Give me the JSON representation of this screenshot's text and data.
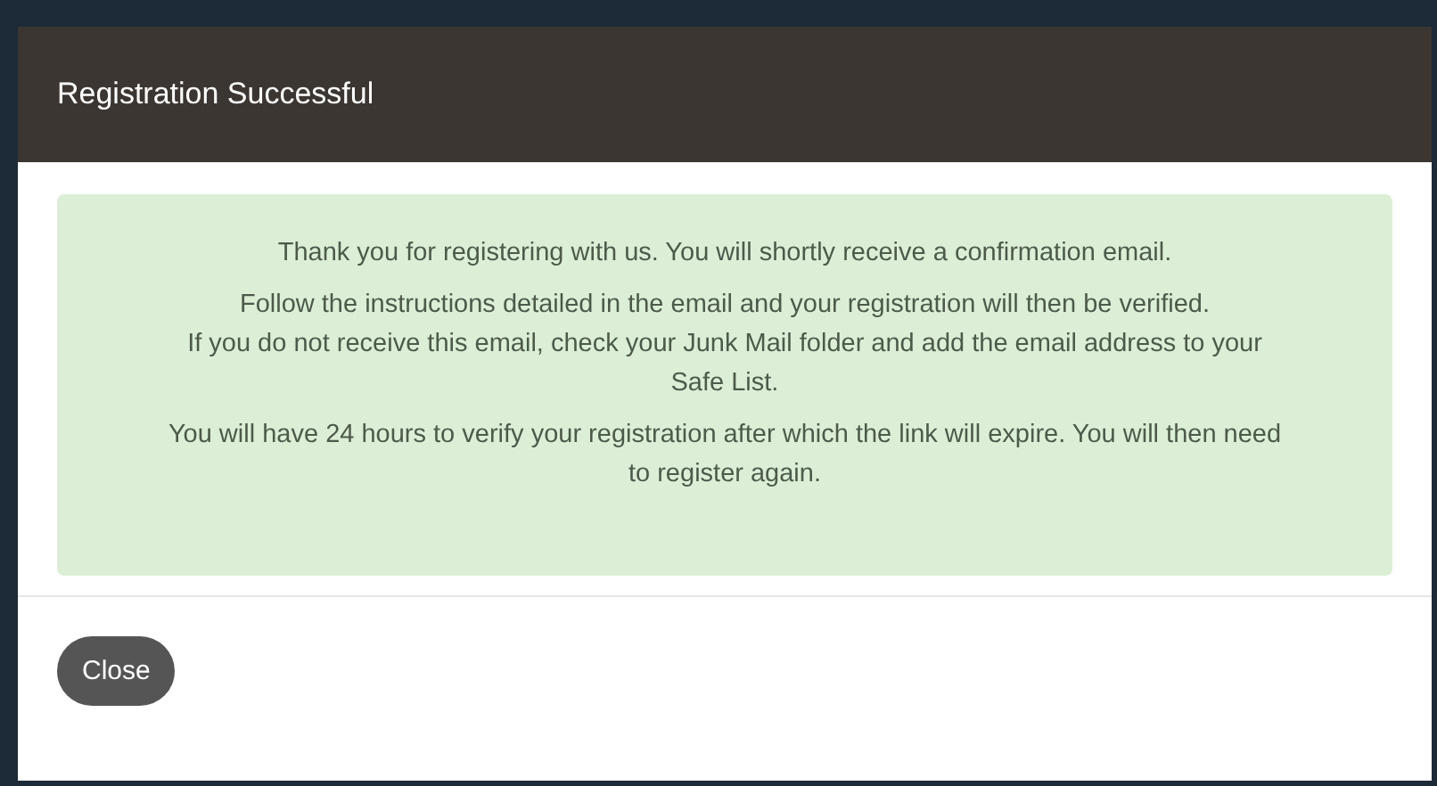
{
  "dialog": {
    "title": "Registration Successful",
    "paragraphs": [
      [
        "Thank you for registering with us. You will shortly receive a confirmation email."
      ],
      [
        "Follow the instructions detailed in the email and your registration will then be verified.",
        "If you do not receive this email, check your Junk Mail folder and add the email address to your Safe List."
      ],
      [
        "You will have 24 hours to verify your registration after which the link will expire. You will then need to register again."
      ]
    ],
    "buttons": [
      {
        "label": "Close"
      }
    ]
  }
}
